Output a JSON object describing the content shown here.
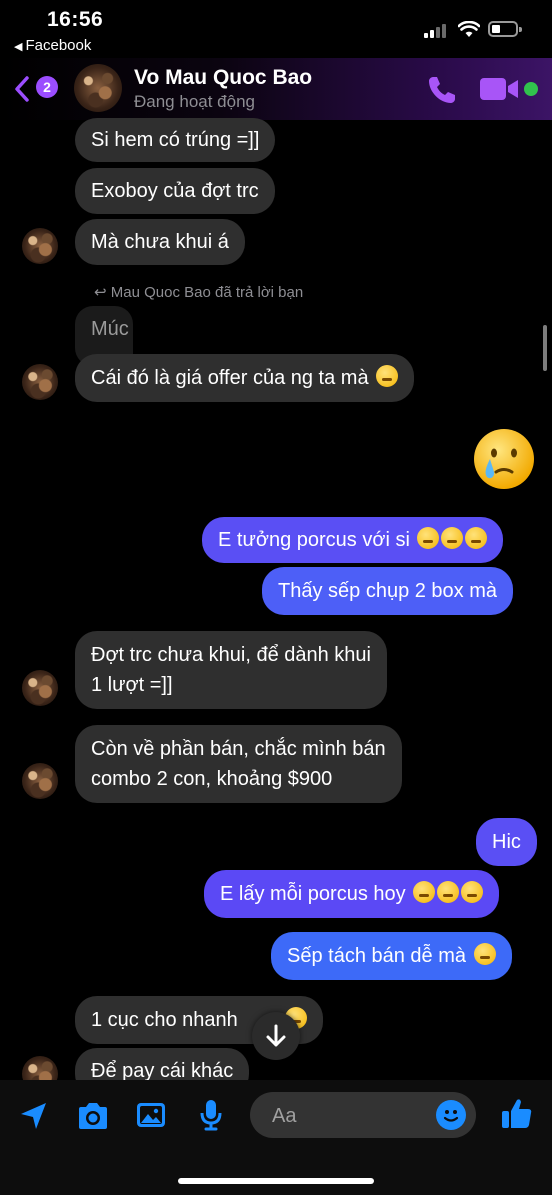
{
  "status_bar": {
    "time": "16:56",
    "back_app": "Facebook"
  },
  "header": {
    "unread_count": "2",
    "contact_name": "Vo Mau Quoc Bao",
    "contact_status": "Đang hoạt động"
  },
  "messages": [
    {
      "text": "Si hem có trúng =]]"
    },
    {
      "text": "Exoboy của đợt trc"
    },
    {
      "text": "Mà chưa khui á"
    },
    {
      "reply_note": "Mau Quoc Bao đã trả lời bạn",
      "quoted": "Múc"
    },
    {
      "text": "Cái đó là giá offer của ng ta mà"
    },
    {
      "text": "E tưởng porcus với si"
    },
    {
      "text": "Thấy sếp chụp 2 box mà"
    },
    {
      "line1": "Đợt trc chưa khui, để dành khui",
      "line2": "1 lượt =]]"
    },
    {
      "line1": "Còn về phần bán, chắc mình bán",
      "line2": "combo 2 con, khoảng $900"
    },
    {
      "text": "Hic"
    },
    {
      "text": "E lấy mỗi porcus hoy"
    },
    {
      "text": "Sếp tách bán dễ mà"
    },
    {
      "text": "1 cục cho nhanh"
    },
    {
      "text": "Để pay cái khác"
    }
  ],
  "composer": {
    "placeholder": "Aa"
  },
  "colors": {
    "incoming_bubble": "#2f2f2f",
    "outgoing_bubble": "#5b49f5",
    "accent": "#1a8cff",
    "header_gradient_end": "#3c1466"
  }
}
